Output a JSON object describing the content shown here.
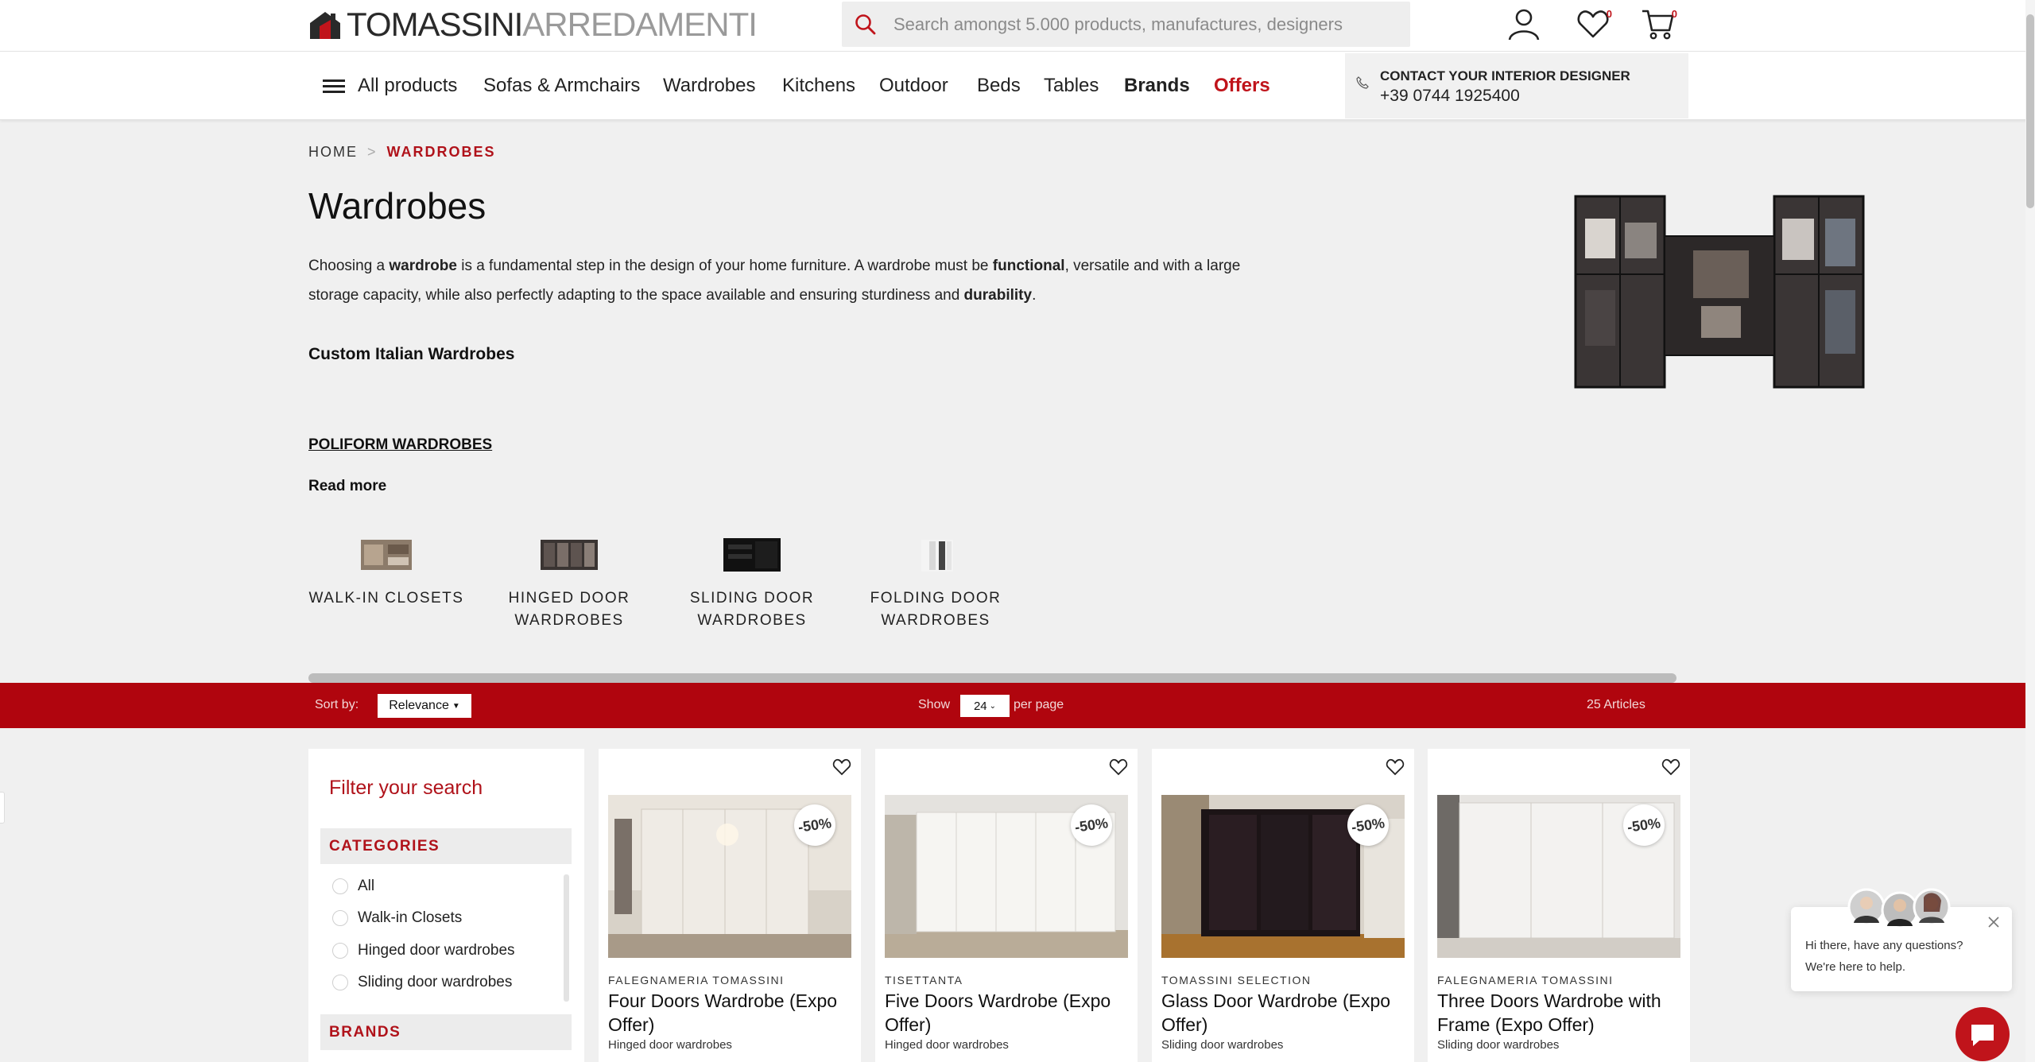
{
  "header": {
    "logo": {
      "part1": "TOMASSINI",
      "part2": "ARREDAMENTI"
    },
    "search": {
      "placeholder": "Search amongst 5.000 products, manufactures, designers",
      "icon": "search-icon"
    },
    "wishlist_count": "0",
    "cart_count": "0"
  },
  "nav": {
    "all_products": "All products",
    "items": [
      "Sofas & Armchairs",
      "Wardrobes",
      "Kitchens",
      "Outdoor",
      "Beds",
      "Tables",
      "Brands",
      "Offers"
    ],
    "contact_title": "CONTACT YOUR INTERIOR DESIGNER",
    "contact_phone": "+39 0744 1925400"
  },
  "breadcrumb": {
    "home": "HOME",
    "sep": ">",
    "current": "WARDROBES"
  },
  "page": {
    "title": "Wardrobes",
    "intro": {
      "t1": "Choosing a ",
      "b1": "wardrobe",
      "t2": " is a fundamental step in the design of your home furniture. A wardrobe must be ",
      "b2": "functional",
      "t3": ", versatile and with a large storage capacity, while also perfectly adapting to the space available and ensuring sturdiness and ",
      "b3": "durability",
      "t4": "."
    },
    "subheading": "Custom Italian Wardrobes",
    "poliform_link": "POLIFORM WARDROBES",
    "read_more": "Read more"
  },
  "categories": [
    {
      "line1": "WALK-IN CLOSETS",
      "line2": ""
    },
    {
      "line1": "HINGED DOOR",
      "line2": "WARDROBES"
    },
    {
      "line1": "SLIDING DOOR",
      "line2": "WARDROBES"
    },
    {
      "line1": "FOLDING DOOR",
      "line2": "WARDROBES"
    }
  ],
  "toolbar": {
    "sort_label": "Sort by:",
    "sort_value": "Relevance",
    "show_label": "Show",
    "per_page_value": "24",
    "per_page_label": "per page",
    "articles": "25 Articles"
  },
  "filter": {
    "title": "Filter your search",
    "categories_heading": "CATEGORIES",
    "options": [
      "All",
      "Walk-in Closets",
      "Hinged door wardrobes",
      "Sliding door wardrobes"
    ],
    "brands_heading": "BRANDS"
  },
  "products": [
    {
      "brand": "FALEGNAMERIA TOMASSINI",
      "name": "Four Doors Wardrobe (Expo Offer)",
      "category": "Hinged door wardrobes",
      "discount": "-50%"
    },
    {
      "brand": "TISETTANTA",
      "name": "Five Doors Wardrobe (Expo Offer)",
      "category": "Hinged door wardrobes",
      "discount": "-50%"
    },
    {
      "brand": "TOMASSINI SELECTION",
      "name": "Glass Door Wardrobe (Expo Offer)",
      "category": "Sliding door wardrobes",
      "discount": "-50%"
    },
    {
      "brand": "FALEGNAMERIA TOMASSINI",
      "name": "Three Doors Wardrobe with Frame (Expo Offer)",
      "category": "Sliding door wardrobes",
      "discount": "-50%"
    }
  ],
  "chat": {
    "line1": "Hi there, have any questions?",
    "line2": "We're here to help."
  },
  "colors": {
    "brand_red": "#b0050e",
    "accent_red": "#c0141b",
    "page_bg": "#f0f0f0"
  }
}
